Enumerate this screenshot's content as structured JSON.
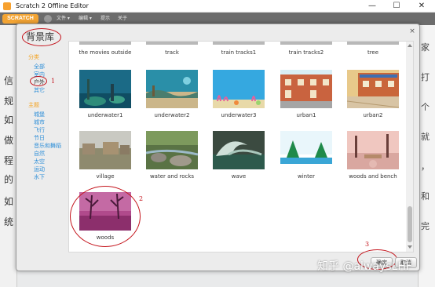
{
  "window": {
    "title": "Scratch 2 Offline Editor",
    "minimize": "—",
    "maximize": "☐",
    "close": "✕"
  },
  "menubar": {
    "logo": "SCRATCH",
    "items": [
      "文件 ▾",
      "编辑 ▾",
      "提示",
      "关于"
    ]
  },
  "background_chars": {
    "left": [
      "信",
      "规",
      "如",
      "做",
      "程",
      "的",
      "如",
      "统"
    ],
    "right": [
      "家",
      "打",
      "个",
      "就",
      "，",
      "和",
      "完"
    ]
  },
  "dialog": {
    "title": "背景库",
    "close": "×",
    "sidebar": {
      "category_header": "分类",
      "categories": [
        "全部",
        "室内",
        "户外",
        "其它"
      ],
      "theme_header": "主题",
      "themes": [
        "城堡",
        "城市",
        "飞行",
        "节日",
        "音乐和舞蹈",
        "自然",
        "太空",
        "运动",
        "水下"
      ]
    },
    "top_row": [
      "the movies outside",
      "track",
      "train tracks1",
      "train tracks2",
      "tree"
    ],
    "rows": [
      [
        "underwater1",
        "underwater2",
        "underwater3",
        "urban1",
        "urban2"
      ],
      [
        "village",
        "water and rocks",
        "wave",
        "winter",
        "woods and bench"
      ],
      [
        "woods"
      ]
    ],
    "ok_label": "确定",
    "cancel_label": "取消",
    "annotations": [
      "1",
      "2",
      "3"
    ]
  },
  "watermark": {
    "prefix": "知乎 ",
    "handle": "@alwaysLHF"
  }
}
